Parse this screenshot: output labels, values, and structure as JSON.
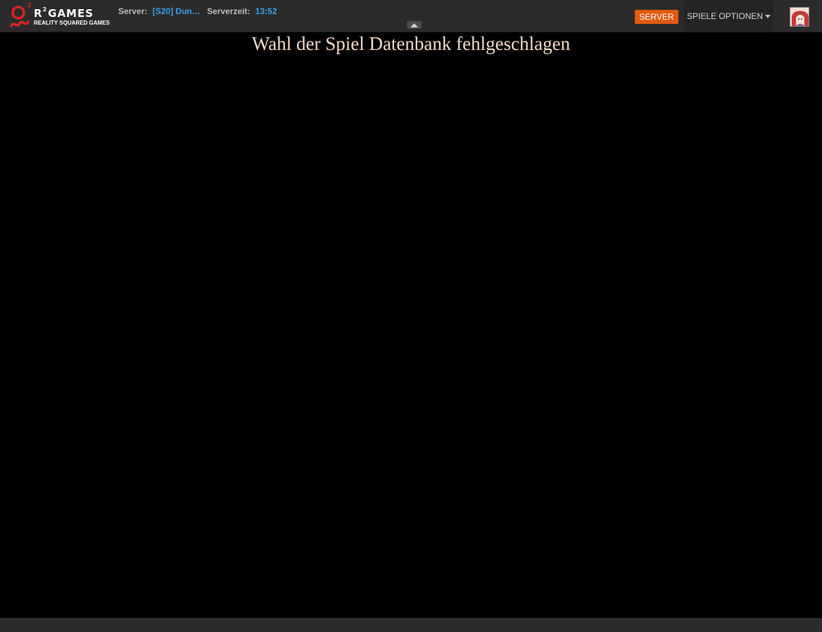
{
  "header": {
    "logo": {
      "superscript": "2",
      "brand_prefix": "R",
      "brand_suffix": "GAMES",
      "subtitle": "REALITY SQUARED GAMES"
    },
    "server_label": "Server:",
    "server_value": "[S20] Dun…",
    "time_label": "Serverzeit:",
    "time_value": "13:52",
    "server_button": "SERVER",
    "options_menu": "SPIELE OPTIONEN",
    "collapse_icon": "triangle-up-icon",
    "caret_icon": "caret-down-icon",
    "avatar_icon": "user-avatar"
  },
  "main": {
    "message": "Wahl der Spiel Datenbank fehlgeschlagen"
  },
  "colors": {
    "topbar": "#2b2b2b",
    "accent_blue": "#3aa0e8",
    "server_button": "#e25a10",
    "message_text": "#f2d8c8",
    "background": "#000000"
  }
}
